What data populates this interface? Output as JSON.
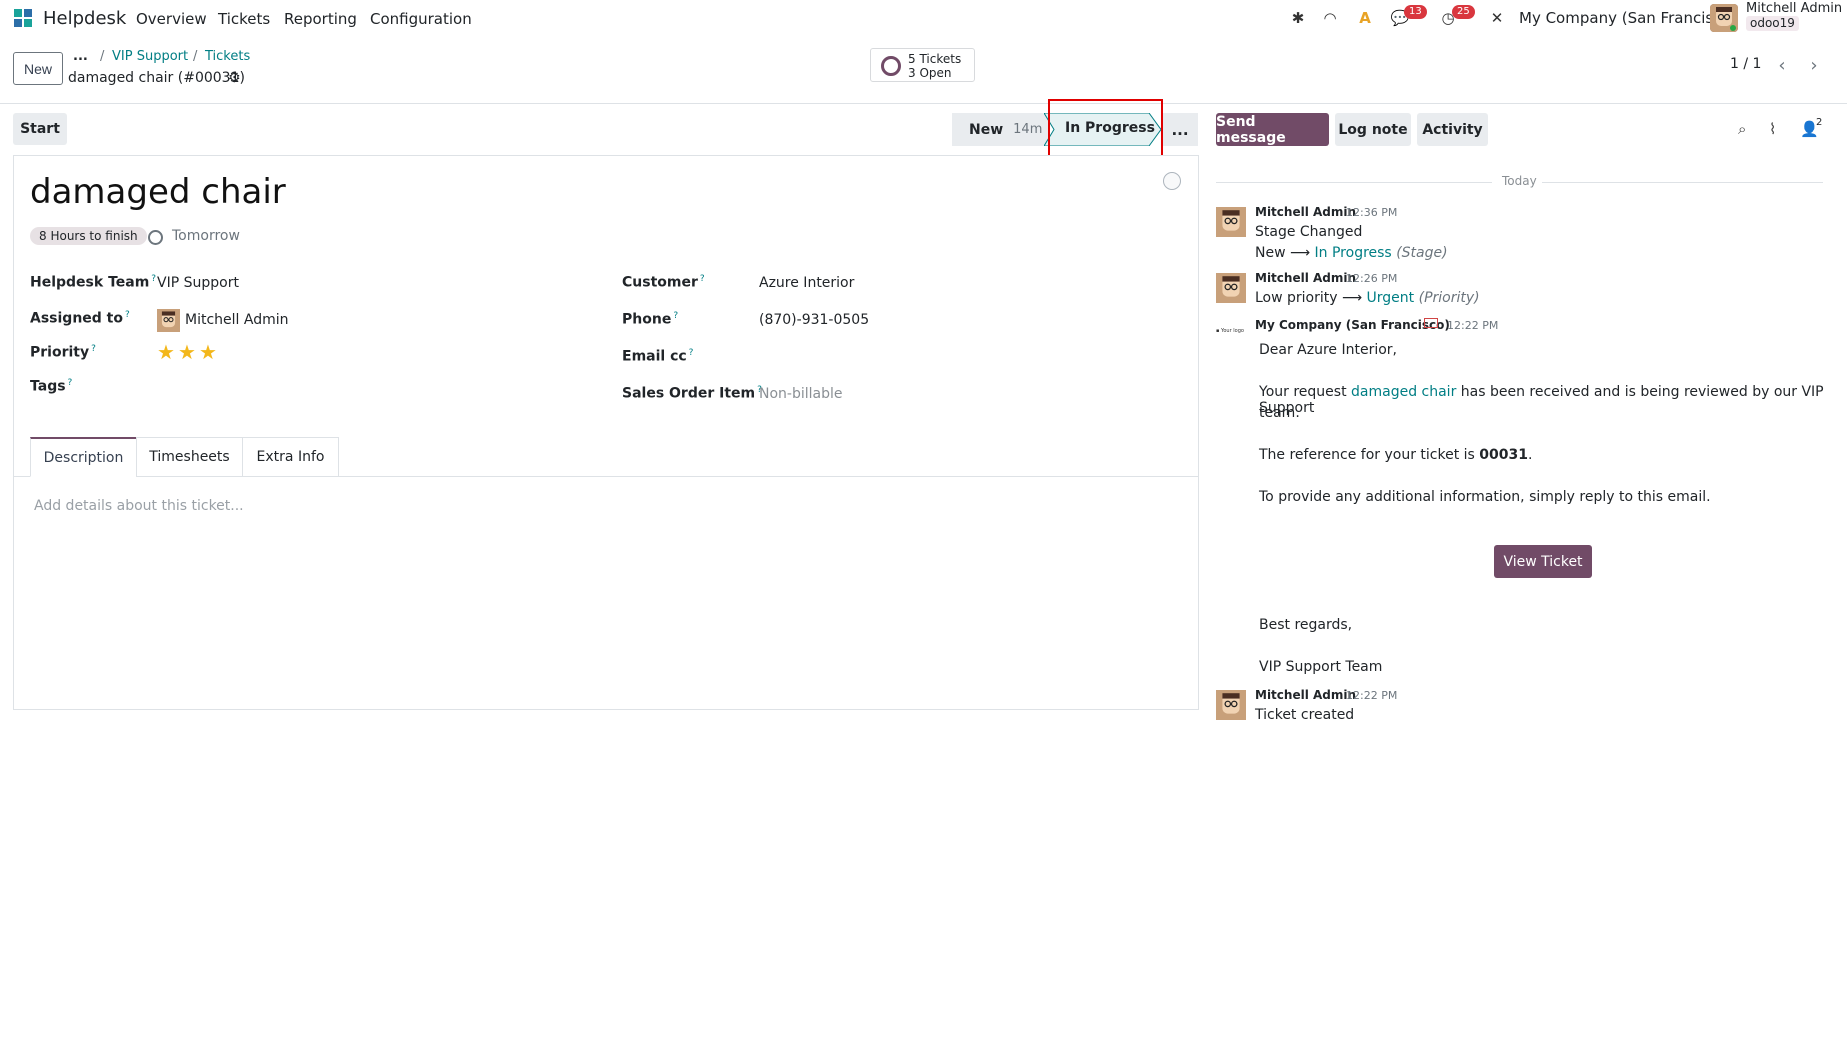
{
  "topbar": {
    "app_name": "Helpdesk",
    "menus": [
      "Overview",
      "Tickets",
      "Reporting",
      "Configuration"
    ],
    "messages_count": "13",
    "activities_count": "25",
    "company": "My Company (San Francisco)",
    "user_name": "Mitchell Admin",
    "db_name": "odoo19"
  },
  "control_panel": {
    "new_button": "New",
    "breadcrumb_more": "...",
    "breadcrumbs": [
      "VIP Support",
      "Tickets"
    ],
    "record_title": "damaged chair (#00031)",
    "smart_button": {
      "line1": "5 Tickets",
      "line2": "3 Open"
    },
    "pager": "1 / 1"
  },
  "statusbar": {
    "start_button": "Start",
    "stages": [
      {
        "label": "New",
        "duration": "14m"
      },
      {
        "label": "In Progress"
      }
    ],
    "more": "..."
  },
  "form": {
    "title": "damaged chair",
    "sla_badge": "8 Hours to finish",
    "deadline": "Tomorrow",
    "left_fields": [
      {
        "label": "Helpdesk Team",
        "value": "VIP Support"
      },
      {
        "label": "Assigned to",
        "value": "Mitchell Admin"
      },
      {
        "label": "Priority",
        "value": ""
      },
      {
        "label": "Tags",
        "value": ""
      }
    ],
    "priority_stars": 3,
    "right_fields": [
      {
        "label": "Customer",
        "value": "Azure Interior"
      },
      {
        "label": "Phone",
        "value": "(870)-931-0505"
      },
      {
        "label": "Email cc",
        "value": ""
      },
      {
        "label": "Sales Order Item",
        "value": "Non-billable"
      }
    ],
    "tabs": [
      "Description",
      "Timesheets",
      "Extra Info"
    ],
    "description_placeholder": "Add details about this ticket..."
  },
  "chatter": {
    "send_message": "Send message",
    "log_note": "Log note",
    "activity": "Activity",
    "followers_count": "2",
    "date_separator": "Today",
    "messages": [
      {
        "author": "Mitchell Admin",
        "time": "12:36 PM",
        "line1": "Stage Changed",
        "from": "New",
        "to": "In Progress",
        "field": "(Stage)"
      },
      {
        "author": "Mitchell Admin",
        "time": "12:26 PM",
        "from": "Low priority",
        "to": "Urgent",
        "field": "(Priority)"
      },
      {
        "author": "My Company (San Francisco)",
        "time": "12:22 PM",
        "greeting": "Dear Azure Interior,",
        "body_pre": "Your request ",
        "body_link": "damaged chair",
        "body_post_1": " has been received and is being reviewed by our VIP Support",
        "body_post_2": "team.",
        "ref_pre": "The reference for your ticket is ",
        "ref_num": "00031",
        "ref_post": ".",
        "info": "To provide any additional information, simply reply to this email.",
        "button": "View Ticket",
        "regards": "Best regards,",
        "signature": "VIP Support Team"
      },
      {
        "author": "Mitchell Admin",
        "time": "12:22 PM",
        "line1": "Ticket created"
      }
    ]
  },
  "colors": {
    "primary": "#714b67",
    "link": "#017e84",
    "star": "#f3b71b",
    "highlight": "#e00000"
  }
}
